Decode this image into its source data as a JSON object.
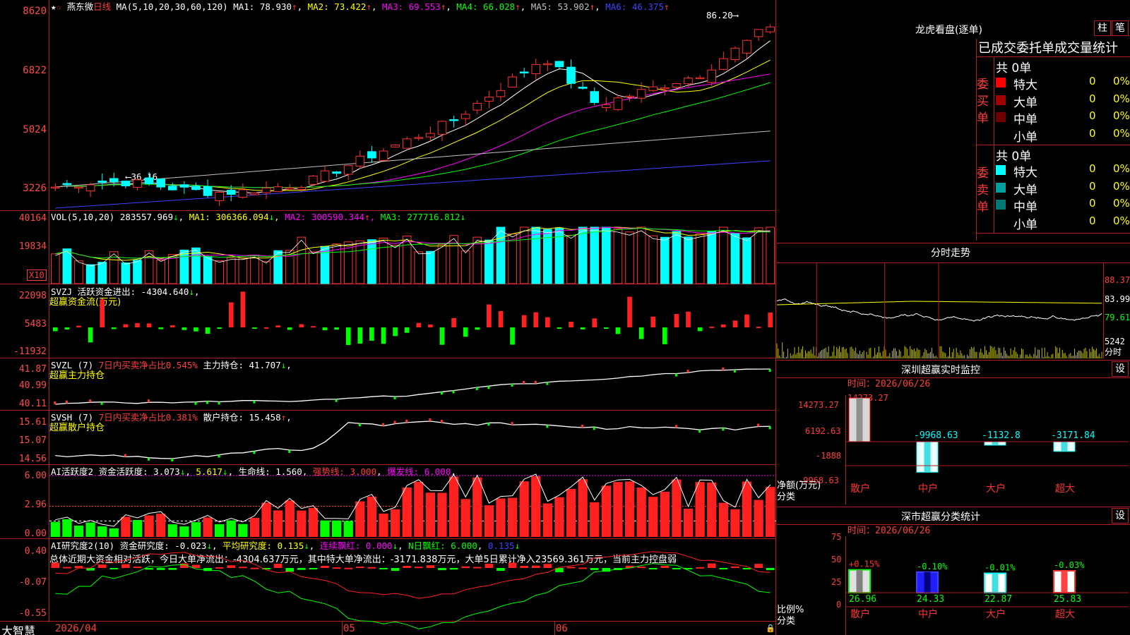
{
  "stock": {
    "name": "燕东微",
    "period": "日线"
  },
  "main_chart": {
    "ma_label": "MA(5,10,20,30,60,120)",
    "ma": [
      {
        "label": "MA1:",
        "value": "78.930",
        "arrow": "↑",
        "color": "#ffffff"
      },
      {
        "label": "MA2:",
        "value": "73.422",
        "arrow": "↑",
        "color": "#ffff00"
      },
      {
        "label": "MA3:",
        "value": "69.553",
        "arrow": "↑",
        "color": "#ff00ff"
      },
      {
        "label": "MA4:",
        "value": "66.028",
        "arrow": "↑",
        "color": "#00ff00"
      },
      {
        "label": "MA5:",
        "value": "53.902",
        "arrow": "↑",
        "color": "#c0c0c0"
      },
      {
        "label": "MA6:",
        "value": "46.375",
        "arrow": "↑",
        "color": "#4040ff"
      }
    ],
    "y_labels": [
      "8620",
      "6822",
      "5024",
      "3226"
    ],
    "high_mark": "86.20",
    "low_mark": "36.16"
  },
  "vol_panel": {
    "title": "VOL(5,10,20)",
    "value": "283557.969",
    "ma1": "306366.094",
    "ma2": "300590.344",
    "ma3": "277716.812",
    "y_labels": [
      "40164",
      "19834"
    ],
    "unit": "X10"
  },
  "svzj_panel": {
    "title": "SVZJ",
    "label": "活跃资金进出:",
    "value": "-4304.640",
    "subtitle": "超赢资金流(万元)",
    "y_labels": [
      "22098",
      "5483",
      "-11932"
    ]
  },
  "svzl_panel": {
    "title": "SVZL (7)",
    "pct_text": "7日内买卖净占比0.545%",
    "label": "主力持仓:",
    "value": "41.707",
    "subtitle": "超赢主力持仓",
    "y_labels": [
      "41.87",
      "40.99",
      "40.11"
    ]
  },
  "svsh_panel": {
    "title": "SVSH (7)",
    "pct_text": "7日内买卖净占比0.381%",
    "label": "散户持仓:",
    "value": "15.458",
    "subtitle": "超赢散户持仓",
    "y_labels": [
      "15.61",
      "15.07",
      "14.56"
    ]
  },
  "ai2_panel": {
    "title": "AI活跃度2",
    "label1": "资金活跃度:",
    "value1": "3.073",
    "value2": "5.617",
    "label3": "生命线:",
    "value3": "1.560",
    "label4": "强势线:",
    "value4": "3.000",
    "label5": "爆发线:",
    "value5": "6.000",
    "y_labels": [
      "6.00",
      "2.96",
      "0.00"
    ]
  },
  "ai_research_panel": {
    "title": "AI研究度2(10)",
    "label1": "资金研究度:",
    "value1": "-0.023",
    "label2": "平均研究度:",
    "value2": "0.135",
    "label3": "连续飘红:",
    "value3": "0.000",
    "label4": "N日飘红:",
    "value4": "6.000",
    "value5": "0.135",
    "summary": "总体近期大资金相对活跃，今日大单净流出：-4304.637万元，其中特大单净流出：-3171.838万元，大单5日累计净入23569.361万元，当前主力控盘弱",
    "y_labels": [
      "0.40",
      "-0.07",
      "-0.55"
    ]
  },
  "bottom_bar": {
    "brand": "大智慧",
    "date": "2026/04",
    "month2": "05",
    "month3": "06"
  },
  "longhu": {
    "title": "龙虎看盘(逐单)",
    "btn1": "柱",
    "btn2": "笔",
    "tabs": "已成交委托单成交量统计",
    "buy": {
      "side_label": "委买单",
      "total": "共 0单",
      "rows": [
        {
          "label": "特大",
          "count": "0",
          "pct": "0%",
          "color": "#ff0000"
        },
        {
          "label": "大单",
          "count": "0",
          "pct": "0%",
          "color": "#a00000"
        },
        {
          "label": "中单",
          "count": "0",
          "pct": "0%",
          "color": "#700000"
        },
        {
          "label": "小单",
          "count": "0",
          "pct": "0%",
          "color": "#000000"
        }
      ]
    },
    "sell": {
      "side_label": "委卖单",
      "total": "共 0单",
      "rows": [
        {
          "label": "特大",
          "count": "0",
          "pct": "0%",
          "color": "#00ffff"
        },
        {
          "label": "大单",
          "count": "0",
          "pct": "0%",
          "color": "#00a0a0"
        },
        {
          "label": "中单",
          "count": "0",
          "pct": "0%",
          "color": "#007878"
        },
        {
          "label": "小单",
          "count": "0",
          "pct": "0%",
          "color": "#000000"
        }
      ]
    }
  },
  "fenshi": {
    "title": "分时走势",
    "y_labels": [
      "88.37",
      "83.99",
      "79.61"
    ],
    "vol_label": "5242",
    "unit": "分时"
  },
  "sz_monitor": {
    "title": "深圳超赢实时监控",
    "btn": "设",
    "time_label": "时间：2026/06/26",
    "top_value": "14273.27",
    "y_labels": [
      "14273.27",
      "6192.63",
      "-1888",
      "-9968.63"
    ],
    "axis_title1": "净额(万元)",
    "axis_title2": "分类",
    "categories": [
      "散户",
      "中户",
      "大户",
      "超大"
    ],
    "values": [
      14273.27,
      -9968.63,
      -1132.8,
      -3171.84
    ],
    "value_labels": [
      "-9968.63",
      "-1132.8",
      "-3171.84"
    ]
  },
  "sz_class": {
    "title": "深市超赢分类统计",
    "btn": "设",
    "time_label": "时间：2026/06/26",
    "y_labels": [
      "75",
      "50",
      "25",
      "0"
    ],
    "axis_title1": "比例%",
    "axis_title2": "分类",
    "categories": [
      "散户",
      "中户",
      "大户",
      "超大"
    ],
    "values": [
      26.96,
      24.33,
      22.87,
      25.83
    ],
    "value_labels": [
      "26.96",
      "24.33",
      "22.87",
      "25.83"
    ],
    "change_labels": [
      "+0.15%",
      "-0.10%",
      "-0.01%",
      "-0.03%"
    ]
  }
}
